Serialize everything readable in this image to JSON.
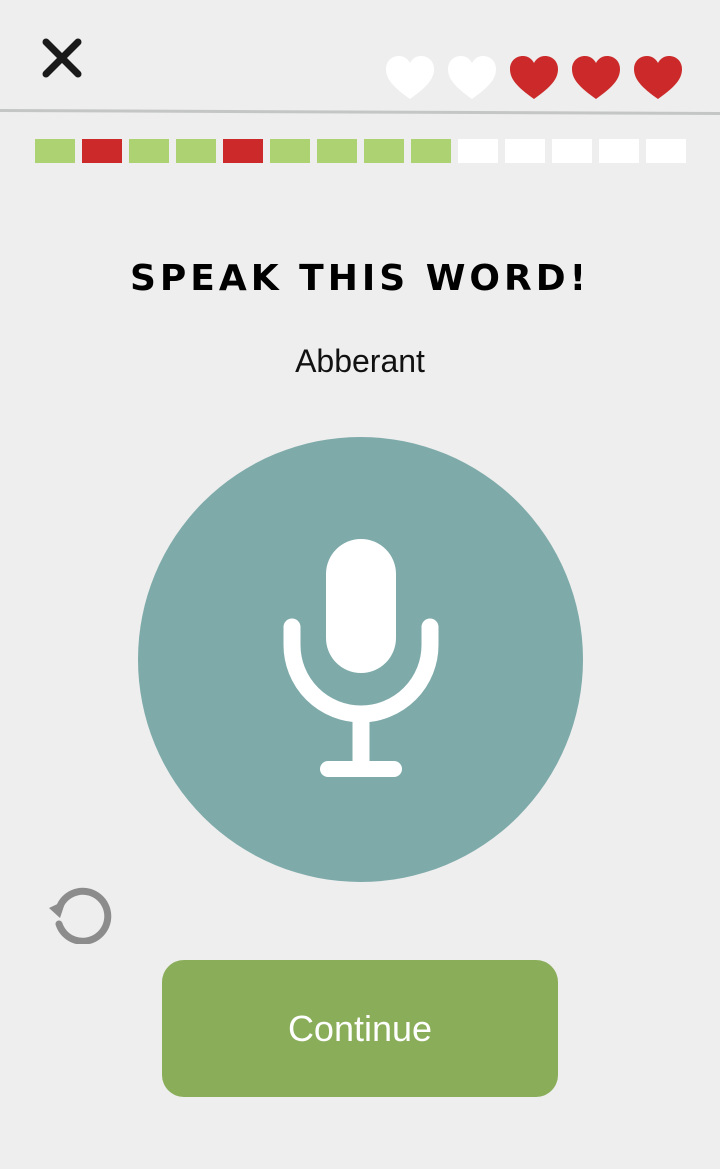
{
  "header": {
    "close_icon": "close-icon",
    "hearts": [
      {
        "state": "empty",
        "color": "#ffffff"
      },
      {
        "state": "empty",
        "color": "#ffffff"
      },
      {
        "state": "full",
        "color": "#cc2a2a"
      },
      {
        "state": "full",
        "color": "#cc2a2a"
      },
      {
        "state": "full",
        "color": "#cc2a2a"
      }
    ]
  },
  "progress": {
    "segments": [
      "correct",
      "wrong",
      "correct",
      "correct",
      "wrong",
      "correct",
      "correct",
      "correct",
      "correct",
      "pending",
      "pending",
      "pending",
      "pending",
      "pending"
    ],
    "colors": {
      "correct": "#acd272",
      "wrong": "#cc2a2a",
      "pending": "#ffffff"
    }
  },
  "prompt": {
    "title": "SPEAK THIS WORD!",
    "word": "Abberant"
  },
  "mic": {
    "icon": "microphone-icon",
    "color": "#7eaaaa"
  },
  "retry": {
    "icon": "retry-icon"
  },
  "actions": {
    "continue_label": "Continue",
    "continue_color": "#8aad5a"
  }
}
